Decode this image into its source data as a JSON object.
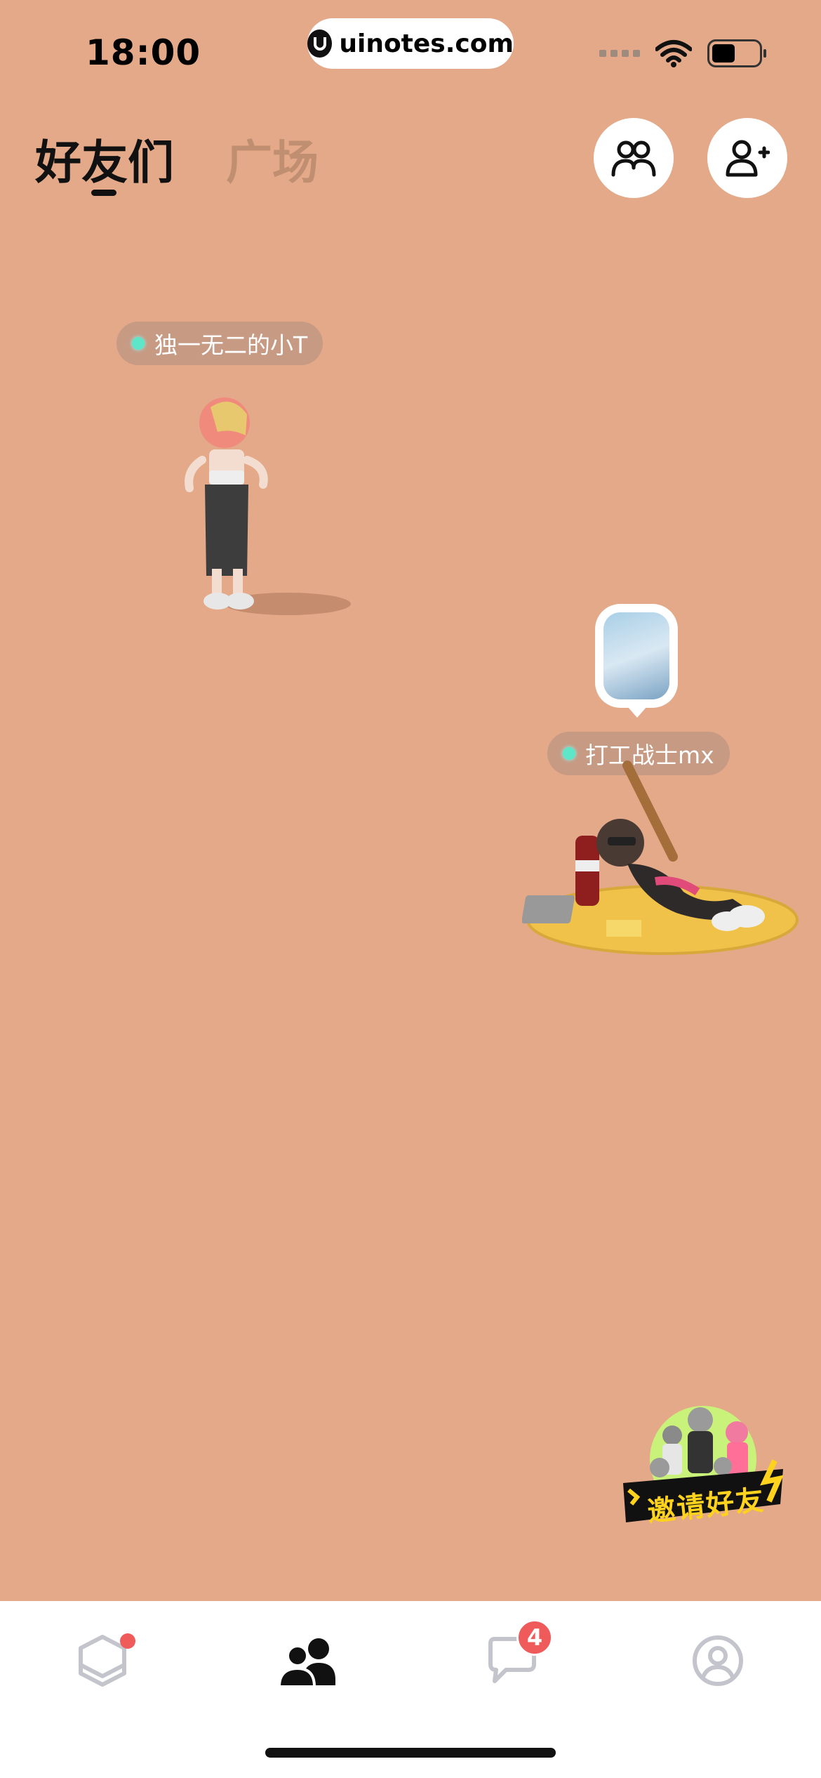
{
  "status_bar": {
    "time": "18:00",
    "url": "uinotes.com"
  },
  "header": {
    "tabs": [
      {
        "label": "好友们",
        "active": true
      },
      {
        "label": "广场",
        "active": false
      }
    ],
    "buttons": [
      {
        "icon": "friends-group-icon"
      },
      {
        "icon": "add-friend-icon"
      }
    ]
  },
  "friends": [
    {
      "name": "独一无二的小T",
      "online": true
    },
    {
      "name": "打工战士mx",
      "online": true
    }
  ],
  "invite": {
    "label": "邀请好友"
  },
  "bottom_nav": {
    "items": [
      {
        "icon": "home-hexagon-icon",
        "badge_dot": true
      },
      {
        "icon": "friends-icon",
        "active": true
      },
      {
        "icon": "chat-icon",
        "badge_count": "4"
      },
      {
        "icon": "profile-icon"
      }
    ]
  },
  "colors": {
    "background": "#e3a988",
    "badge": "#ef5a5a",
    "online": "#5de6c8"
  }
}
